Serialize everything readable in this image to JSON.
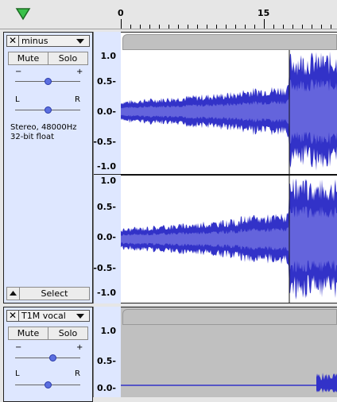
{
  "timeline": {
    "ticks": [
      "0",
      "15"
    ]
  },
  "colors": {
    "panel": "#dee7ff",
    "wave": "#3232c8",
    "rms": "#6464dc",
    "selected_bg": "#ffffff",
    "unselected_bg": "#c0c0c0"
  },
  "tracks": [
    {
      "name": "minus",
      "mute_label": "Mute",
      "solo_label": "Solo",
      "gain_minus": "−",
      "gain_plus": "+",
      "pan_left": "L",
      "pan_right": "R",
      "info_line1": "Stereo, 48000Hz",
      "info_line2": "32-bit float",
      "select_label": "Select",
      "scale_labels": [
        "1.0",
        "0.5-",
        "0.0-",
        "-0.5-",
        "-1.0"
      ],
      "scale_labels2": [
        "1.0",
        "0.5-",
        "0.0-",
        "-0.5-",
        "-1.0"
      ]
    },
    {
      "name": "T1M vocal",
      "mute_label": "Mute",
      "solo_label": "Solo",
      "gain_minus": "−",
      "gain_plus": "+",
      "pan_left": "L",
      "pan_right": "R",
      "scale_labels": [
        "1.0",
        "0.5-",
        "0.0-"
      ]
    }
  ]
}
